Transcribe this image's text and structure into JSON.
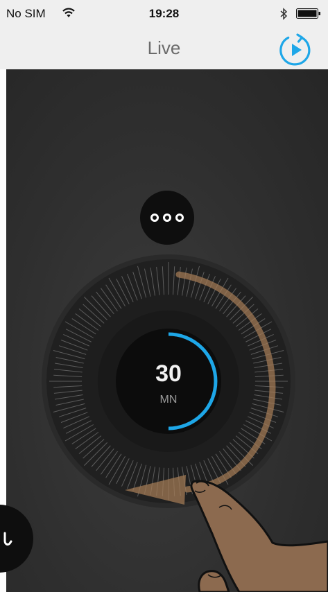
{
  "status_bar": {
    "carrier": "No SIM",
    "time": "19:28",
    "wifi_icon": "wifi-icon",
    "bluetooth_icon": "bluetooth-icon",
    "battery_icon": "battery-icon"
  },
  "nav": {
    "title": "Live",
    "replay_icon": "replay-play-icon"
  },
  "timer": {
    "value": "30",
    "unit": "MN",
    "progress": 0.5
  },
  "colors": {
    "accent": "#1ea7e8",
    "background": "#2f2f2f",
    "hint_arrow": "#a57c56"
  }
}
